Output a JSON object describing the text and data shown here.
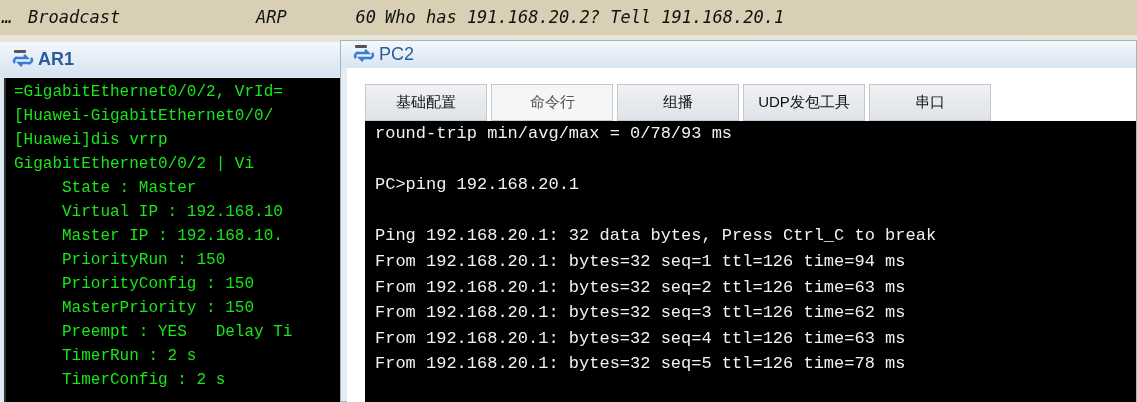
{
  "packet_row": {
    "marker": "…",
    "destination": "Broadcast",
    "protocol": "ARP",
    "length": "60",
    "info": "Who has 191.168.20.2? Tell 191.168.20.1"
  },
  "ar1": {
    "title": "AR1",
    "lines": [
      {
        "text": "=GigabitEthernet0/0/2, VrId="
      },
      {
        "text": "[Huawei-GigabitEthernet0/0/"
      },
      {
        "text": "[Huawei]dis vrrp"
      },
      {
        "text": "GigabitEthernet0/0/2 | Vi",
        "children": [
          {
            "text": "State : Master"
          },
          {
            "text": "Virtual IP : 192.168.10"
          },
          {
            "text": "Master IP : 192.168.10."
          },
          {
            "text": "PriorityRun : 150"
          },
          {
            "text": "PriorityConfig : 150"
          },
          {
            "text": "MasterPriority : 150"
          },
          {
            "text": "Preempt : YES   Delay Ti"
          },
          {
            "text": "TimerRun : 2 s"
          },
          {
            "text": "TimerConfig : 2 s"
          }
        ]
      }
    ]
  },
  "pc2": {
    "title": "PC2",
    "tabs": [
      {
        "label": "基础配置",
        "selected": false
      },
      {
        "label": "命令行",
        "selected": true
      },
      {
        "label": "组播",
        "selected": false
      },
      {
        "label": "UDP发包工具",
        "selected": false
      },
      {
        "label": "串口",
        "selected": false
      }
    ],
    "output_blocks": [
      [
        "round-trip min/avg/max = 0/78/93 ms"
      ],
      [
        "PC>ping 192.168.20.1"
      ],
      [
        "Ping 192.168.20.1: 32 data bytes, Press Ctrl_C to break",
        "From 192.168.20.1: bytes=32 seq=1 ttl=126 time=94 ms",
        "From 192.168.20.1: bytes=32 seq=2 ttl=126 time=63 ms",
        "From 192.168.20.1: bytes=32 seq=3 ttl=126 time=62 ms",
        "From 192.168.20.1: bytes=32 seq=4 ttl=126 time=63 ms",
        "From 192.168.20.1: bytes=32 seq=5 ttl=126 time=78 ms"
      ]
    ]
  }
}
